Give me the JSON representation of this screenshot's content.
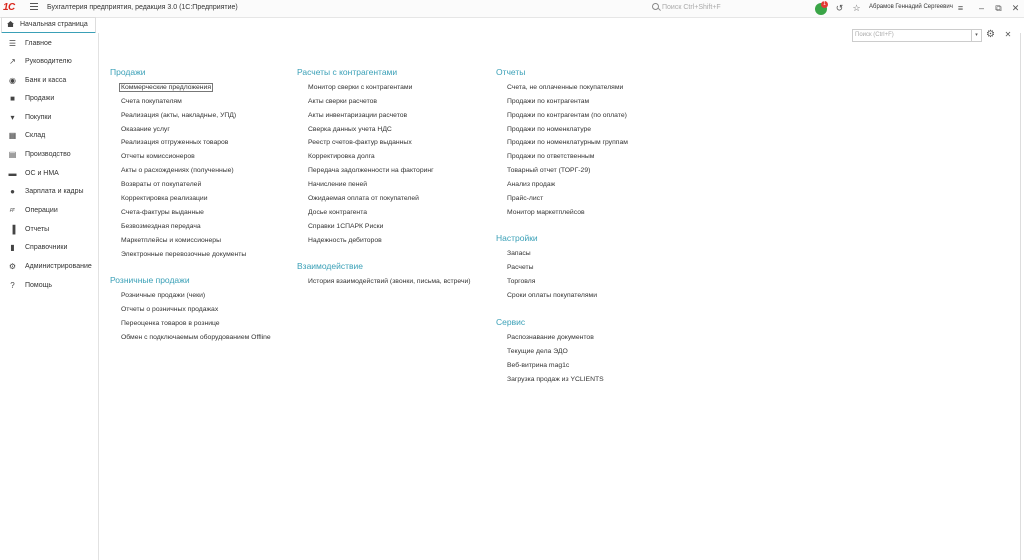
{
  "window": {
    "app_title": "Бухгалтерия предприятия, редакция 3.0  (1С:Предприятие)",
    "logo": "1С",
    "global_search_placeholder": "Поиск Ctrl+Shift+F",
    "notification_count": "1",
    "user_name": "Абрамов Геннадий Сергеевич"
  },
  "tabs": {
    "home": "Начальная страница"
  },
  "sidebar": {
    "items": [
      {
        "label": "Главное",
        "icon": "menu-lines-icon"
      },
      {
        "label": "Руководителю",
        "icon": "trend-icon"
      },
      {
        "label": "Банк и касса",
        "icon": "coin-icon"
      },
      {
        "label": "Продажи",
        "icon": "bag-icon"
      },
      {
        "label": "Покупки",
        "icon": "cart-icon"
      },
      {
        "label": "Склад",
        "icon": "boxes-icon"
      },
      {
        "label": "Производство",
        "icon": "factory-icon"
      },
      {
        "label": "ОС и НМА",
        "icon": "truck-icon"
      },
      {
        "label": "Зарплата и кадры",
        "icon": "person-icon"
      },
      {
        "label": "Операции",
        "icon": "dt-kt-icon"
      },
      {
        "label": "Отчеты",
        "icon": "bar-chart-icon"
      },
      {
        "label": "Справочники",
        "icon": "book-icon"
      },
      {
        "label": "Администрирование",
        "icon": "gear-icon"
      },
      {
        "label": "Помощь",
        "icon": "question-icon"
      }
    ]
  },
  "local_search": {
    "placeholder": "Поиск (Ctrl+F)"
  },
  "columns": {
    "sales": {
      "title": "Продажи",
      "links": [
        "Коммерческие предложения",
        "Счета покупателям",
        "Реализация (акты, накладные, УПД)",
        "Оказание услуг",
        "Реализация отгруженных товаров",
        "Отчеты комиссионеров",
        "Акты о расхождениях (полученные)",
        "Возвраты от покупателей",
        "Корректировка реализации",
        "Счета-фактуры выданные",
        "Безвозмездная передача",
        "Маркетплейсы и комиссионеры",
        "Электронные перевозочные документы"
      ]
    },
    "retail": {
      "title": "Розничные продажи",
      "links": [
        "Розничные продажи (чеки)",
        "Отчеты о розничных продажах",
        "Переоценка товаров в рознице",
        "Обмен с подключаемым оборудованием Offline"
      ]
    },
    "settlements": {
      "title": "Расчеты с контрагентами",
      "links": [
        "Монитор сверки с контрагентами",
        "Акты сверки расчетов",
        "Акты инвентаризации расчетов",
        "Сверка данных учета НДС",
        "Реестр счетов-фактур выданных",
        "Корректировка долга",
        "Передача задолженности на факторинг",
        "Начисление пеней",
        "Ожидаемая оплата от покупателей",
        "Досье контрагента",
        "Справки 1СПАРК Риски",
        "Надежность дебиторов"
      ]
    },
    "interaction": {
      "title": "Взаимодействие",
      "links": [
        "История взаимодействий (звонки, письма, встречи)"
      ]
    },
    "reports": {
      "title": "Отчеты",
      "links": [
        "Счета, не оплаченные покупателями",
        "Продажи по контрагентам",
        "Продажи по контрагентам (по оплате)",
        "Продажи по номенклатуре",
        "Продажи по номенклатурным группам",
        "Продажи по ответственным",
        "Товарный отчет (ТОРГ-29)",
        "Анализ продаж",
        "Прайс-лист",
        "Монитор маркетплейсов"
      ]
    },
    "settings": {
      "title": "Настройки",
      "links": [
        "Запасы",
        "Расчеты",
        "Торговля",
        "Сроки оплаты покупателями"
      ]
    },
    "service": {
      "title": "Сервис",
      "links": [
        "Распознавание документов",
        "Текущие дела ЭДО",
        "Веб-витрина mag1c",
        "Загрузка продаж из YCLIENTS"
      ]
    }
  },
  "colors": {
    "accent": "#3aa0b7",
    "logo_red": "#d9261c",
    "notify_green": "#3aa547"
  }
}
